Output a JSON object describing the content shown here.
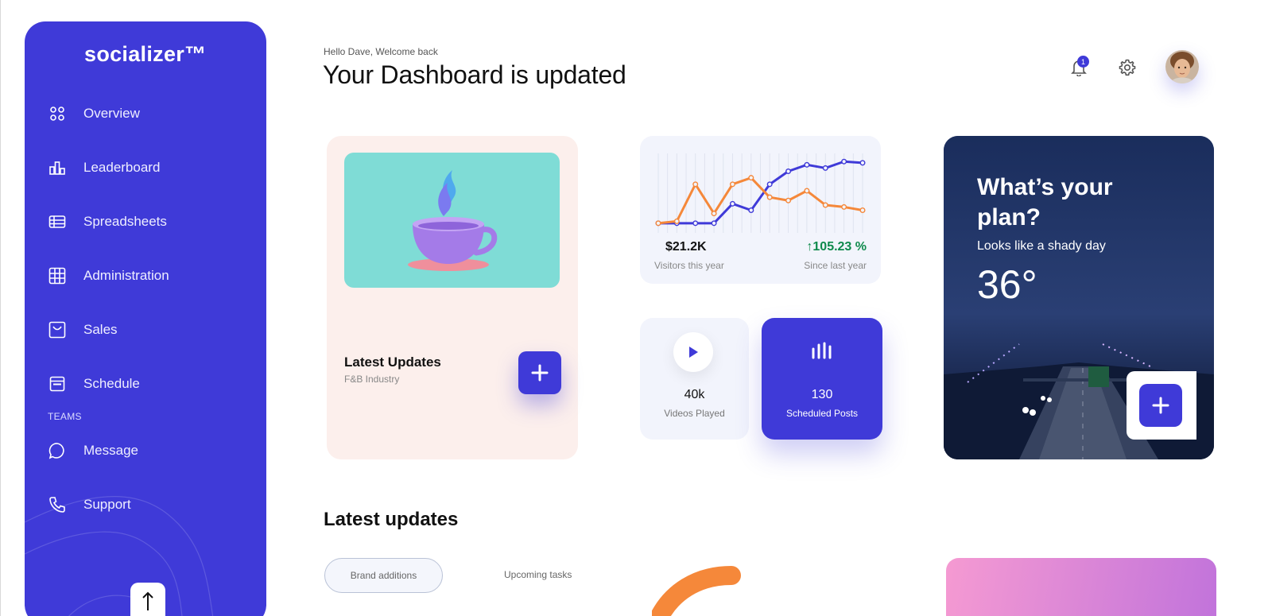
{
  "sidebar": {
    "brand": "socializer™",
    "items": [
      {
        "label": "Overview",
        "icon": "grid-icon"
      },
      {
        "label": "Leaderboard",
        "icon": "bar-chart-icon"
      },
      {
        "label": "Spreadsheets",
        "icon": "spreadsheet-icon"
      },
      {
        "label": "Administration",
        "icon": "table-grid-icon"
      },
      {
        "label": "Sales",
        "icon": "shopping-bag-icon"
      },
      {
        "label": "Schedule",
        "icon": "calendar-icon"
      }
    ],
    "teams_label": "TEAMS",
    "team_items": [
      {
        "label": "Message",
        "icon": "chat-bubble-icon"
      },
      {
        "label": "Support",
        "icon": "phone-icon"
      }
    ]
  },
  "header": {
    "greeting": "Hello Dave, Welcome back",
    "title": "Your Dashboard is updated",
    "notification_count": "1"
  },
  "updates_card": {
    "title": "Latest Updates",
    "subtitle": "F&B Industry"
  },
  "chart_card": {
    "visitors_value": "$21.2K",
    "visitors_label": "Visitors this year",
    "growth_value": "↑105.23 %",
    "growth_label": "Since last year"
  },
  "chart_data": {
    "type": "line",
    "x": [
      1,
      2,
      3,
      4,
      5,
      6,
      7,
      8,
      9,
      10,
      11,
      12
    ],
    "series": [
      {
        "color": "#3f3ad8",
        "values": [
          1,
          1,
          1,
          1,
          4,
          3,
          7,
          9,
          10,
          9.5,
          10.5,
          10.3
        ]
      },
      {
        "color": "#f5883a",
        "values": [
          1,
          1.3,
          7,
          2.5,
          7,
          8,
          5,
          4.5,
          6,
          3.8,
          3.5,
          3
        ]
      }
    ],
    "ylim": [
      0,
      12
    ],
    "grid": "vertical"
  },
  "videos_card": {
    "value": "40k",
    "label": "Videos Played"
  },
  "posts_card": {
    "value": "130",
    "label": "Scheduled Posts"
  },
  "weather": {
    "title": "What’s your plan?",
    "subtitle": "Looks like a shady day",
    "temperature": "36°"
  },
  "lower": {
    "section_title": "Latest updates",
    "tabs": [
      "Brand additions",
      "Upcoming tasks"
    ]
  },
  "colors": {
    "accent": "#3f3ad8",
    "orange": "#f5883a",
    "growth_green": "#0f8a4c",
    "peach_card": "#fcefec"
  }
}
